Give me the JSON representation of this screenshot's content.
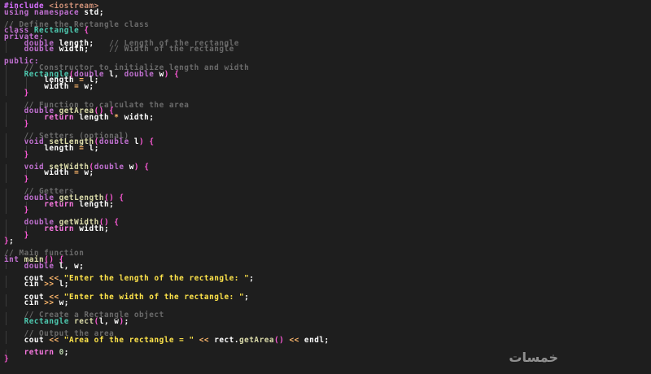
{
  "editor": {
    "colors": {
      "background": "#1e1e1e",
      "pre": "#d870ff",
      "inc": "#ce9178",
      "kw": "#c070d0",
      "kwd": "#f878e0",
      "ty": "#4ec9b0",
      "fn": "#dcdcaa",
      "id": "#ffffff",
      "str": "#ffe44a",
      "num": "#b5cea8",
      "cm": "#6a6a6a",
      "br": "#ff5ad8",
      "op": "#ffb86c",
      "pun": "#ffffff"
    },
    "lines": [
      [
        [
          "pre",
          "#include "
        ],
        [
          "inc",
          "<iostream>"
        ]
      ],
      [
        [
          "kw",
          "using namespace "
        ],
        [
          "id",
          "std"
        ],
        [
          "pun",
          ";"
        ]
      ],
      [],
      [
        [
          "cm",
          "// Define the Rectangle class"
        ]
      ],
      [
        [
          "kw",
          "class "
        ],
        [
          "ty",
          "Rectangle "
        ],
        [
          "br",
          "{"
        ]
      ],
      [
        [
          "kw",
          "private:"
        ]
      ],
      [
        [
          "pun",
          "    "
        ],
        [
          "kw",
          "double "
        ],
        [
          "id",
          "length"
        ],
        [
          "pun",
          ";   "
        ],
        [
          "cm",
          "// Length of the rectangle"
        ]
      ],
      [
        [
          "pun",
          "    "
        ],
        [
          "kw",
          "double "
        ],
        [
          "id",
          "width"
        ],
        [
          "pun",
          ";    "
        ],
        [
          "cm",
          "// Width of the rectangle"
        ]
      ],
      [],
      [
        [
          "kw",
          "public:"
        ]
      ],
      [
        [
          "pun",
          "    "
        ],
        [
          "cm",
          "// Constructor to initialize length and width"
        ]
      ],
      [
        [
          "pun",
          "    "
        ],
        [
          "ty",
          "Rectangle"
        ],
        [
          "br",
          "("
        ],
        [
          "kw",
          "double "
        ],
        [
          "id",
          "l"
        ],
        [
          "pun",
          ", "
        ],
        [
          "kw",
          "double "
        ],
        [
          "id",
          "w"
        ],
        [
          "br",
          ")"
        ],
        [
          "pun",
          " "
        ],
        [
          "br",
          "{"
        ]
      ],
      [
        [
          "pun",
          "        "
        ],
        [
          "id",
          "length "
        ],
        [
          "op",
          "="
        ],
        [
          "pun",
          " "
        ],
        [
          "id",
          "l"
        ],
        [
          "pun",
          ";"
        ]
      ],
      [
        [
          "pun",
          "        "
        ],
        [
          "id",
          "width "
        ],
        [
          "op",
          "="
        ],
        [
          "pun",
          " "
        ],
        [
          "id",
          "w"
        ],
        [
          "pun",
          ";"
        ]
      ],
      [
        [
          "pun",
          "    "
        ],
        [
          "br",
          "}"
        ]
      ],
      [],
      [
        [
          "pun",
          "    "
        ],
        [
          "cm",
          "// Function to calculate the area"
        ]
      ],
      [
        [
          "pun",
          "    "
        ],
        [
          "kw",
          "double "
        ],
        [
          "fn",
          "getArea"
        ],
        [
          "br",
          "()"
        ],
        [
          "pun",
          " "
        ],
        [
          "br",
          "{"
        ]
      ],
      [
        [
          "pun",
          "        "
        ],
        [
          "kwd",
          "return "
        ],
        [
          "id",
          "length "
        ],
        [
          "op",
          "*"
        ],
        [
          "pun",
          " "
        ],
        [
          "id",
          "width"
        ],
        [
          "pun",
          ";"
        ]
      ],
      [
        [
          "pun",
          "    "
        ],
        [
          "br",
          "}"
        ]
      ],
      [],
      [
        [
          "pun",
          "    "
        ],
        [
          "cm",
          "// Setters (optional)"
        ]
      ],
      [
        [
          "pun",
          "    "
        ],
        [
          "kw",
          "void "
        ],
        [
          "fn",
          "setLength"
        ],
        [
          "br",
          "("
        ],
        [
          "kw",
          "double "
        ],
        [
          "id",
          "l"
        ],
        [
          "br",
          ")"
        ],
        [
          "pun",
          " "
        ],
        [
          "br",
          "{"
        ]
      ],
      [
        [
          "pun",
          "        "
        ],
        [
          "id",
          "length "
        ],
        [
          "op",
          "="
        ],
        [
          "pun",
          " "
        ],
        [
          "id",
          "l"
        ],
        [
          "pun",
          ";"
        ]
      ],
      [
        [
          "pun",
          "    "
        ],
        [
          "br",
          "}"
        ]
      ],
      [],
      [
        [
          "pun",
          "    "
        ],
        [
          "kw",
          "void "
        ],
        [
          "fn",
          "setWidth"
        ],
        [
          "br",
          "("
        ],
        [
          "kw",
          "double "
        ],
        [
          "id",
          "w"
        ],
        [
          "br",
          ")"
        ],
        [
          "pun",
          " "
        ],
        [
          "br",
          "{"
        ]
      ],
      [
        [
          "pun",
          "        "
        ],
        [
          "id",
          "width "
        ],
        [
          "op",
          "="
        ],
        [
          "pun",
          " "
        ],
        [
          "id",
          "w"
        ],
        [
          "pun",
          ";"
        ]
      ],
      [
        [
          "pun",
          "    "
        ],
        [
          "br",
          "}"
        ]
      ],
      [],
      [
        [
          "pun",
          "    "
        ],
        [
          "cm",
          "// Getters"
        ]
      ],
      [
        [
          "pun",
          "    "
        ],
        [
          "kw",
          "double "
        ],
        [
          "fn",
          "getLength"
        ],
        [
          "br",
          "()"
        ],
        [
          "pun",
          " "
        ],
        [
          "br",
          "{"
        ]
      ],
      [
        [
          "pun",
          "        "
        ],
        [
          "kwd",
          "return "
        ],
        [
          "id",
          "length"
        ],
        [
          "pun",
          ";"
        ]
      ],
      [
        [
          "pun",
          "    "
        ],
        [
          "br",
          "}"
        ]
      ],
      [],
      [
        [
          "pun",
          "    "
        ],
        [
          "kw",
          "double "
        ],
        [
          "fn",
          "getWidth"
        ],
        [
          "br",
          "()"
        ],
        [
          "pun",
          " "
        ],
        [
          "br",
          "{"
        ]
      ],
      [
        [
          "pun",
          "        "
        ],
        [
          "kwd",
          "return "
        ],
        [
          "id",
          "width"
        ],
        [
          "pun",
          ";"
        ]
      ],
      [
        [
          "pun",
          "    "
        ],
        [
          "br",
          "}"
        ]
      ],
      [
        [
          "br",
          "}"
        ],
        [
          "pun",
          ";"
        ]
      ],
      [],
      [
        [
          "cm",
          "// Main function"
        ]
      ],
      [
        [
          "kw",
          "int "
        ],
        [
          "fn",
          "main"
        ],
        [
          "br",
          "()"
        ],
        [
          "pun",
          " "
        ],
        [
          "br",
          "{"
        ]
      ],
      [
        [
          "pun",
          "    "
        ],
        [
          "kw",
          "double "
        ],
        [
          "id",
          "l"
        ],
        [
          "pun",
          ", "
        ],
        [
          "id",
          "w"
        ],
        [
          "pun",
          ";"
        ]
      ],
      [],
      [
        [
          "pun",
          "    "
        ],
        [
          "id",
          "cout "
        ],
        [
          "op",
          "<<"
        ],
        [
          "pun",
          " "
        ],
        [
          "str",
          "\"Enter the length of the rectangle: \""
        ],
        [
          "pun",
          ";"
        ]
      ],
      [
        [
          "pun",
          "    "
        ],
        [
          "id",
          "cin "
        ],
        [
          "op",
          ">>"
        ],
        [
          "pun",
          " "
        ],
        [
          "id",
          "l"
        ],
        [
          "pun",
          ";"
        ]
      ],
      [],
      [
        [
          "pun",
          "    "
        ],
        [
          "id",
          "cout "
        ],
        [
          "op",
          "<<"
        ],
        [
          "pun",
          " "
        ],
        [
          "str",
          "\"Enter the width of the rectangle: \""
        ],
        [
          "pun",
          ";"
        ]
      ],
      [
        [
          "pun",
          "    "
        ],
        [
          "id",
          "cin "
        ],
        [
          "op",
          ">>"
        ],
        [
          "pun",
          " "
        ],
        [
          "id",
          "w"
        ],
        [
          "pun",
          ";"
        ]
      ],
      [],
      [
        [
          "pun",
          "    "
        ],
        [
          "cm",
          "// Create a Rectangle object"
        ]
      ],
      [
        [
          "pun",
          "    "
        ],
        [
          "ty",
          "Rectangle "
        ],
        [
          "fn",
          "rect"
        ],
        [
          "br",
          "("
        ],
        [
          "id",
          "l"
        ],
        [
          "pun",
          ", "
        ],
        [
          "id",
          "w"
        ],
        [
          "br",
          ")"
        ],
        [
          "pun",
          ";"
        ]
      ],
      [],
      [
        [
          "pun",
          "    "
        ],
        [
          "cm",
          "// Output the area"
        ]
      ],
      [
        [
          "pun",
          "    "
        ],
        [
          "id",
          "cout "
        ],
        [
          "op",
          "<<"
        ],
        [
          "pun",
          " "
        ],
        [
          "str",
          "\"Area of the rectangle = \""
        ],
        [
          "pun",
          " "
        ],
        [
          "op",
          "<<"
        ],
        [
          "pun",
          " "
        ],
        [
          "id",
          "rect"
        ],
        [
          "pun",
          "."
        ],
        [
          "fn",
          "getArea"
        ],
        [
          "br",
          "()"
        ],
        [
          "pun",
          " "
        ],
        [
          "op",
          "<<"
        ],
        [
          "pun",
          " "
        ],
        [
          "id",
          "endl"
        ],
        [
          "pun",
          ";"
        ]
      ],
      [],
      [
        [
          "pun",
          "    "
        ],
        [
          "kwd",
          "return "
        ],
        [
          "num",
          "0"
        ],
        [
          "pun",
          ";"
        ]
      ],
      [
        [
          "br",
          "}"
        ]
      ]
    ]
  },
  "watermark": {
    "text": "خمسات",
    "icon": "khamsat-logo-icon"
  }
}
